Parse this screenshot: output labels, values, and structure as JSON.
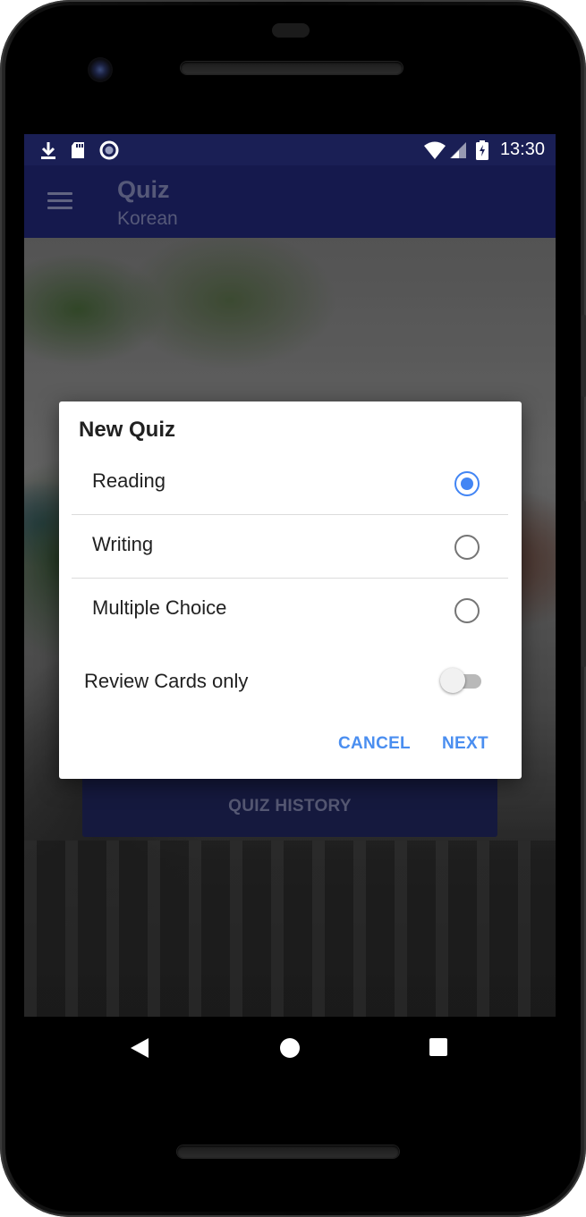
{
  "status_bar": {
    "time": "13:30",
    "left_icons": [
      "download-icon",
      "sd-card-icon",
      "record-icon"
    ],
    "right_icons": [
      "wifi-icon",
      "signal-icon",
      "battery-charging-icon"
    ]
  },
  "app_bar": {
    "title": "Quiz",
    "subtitle": "Korean",
    "menu_icon": "hamburger-menu-icon"
  },
  "background": {
    "quiz_history_label": "QUIZ HISTORY"
  },
  "dialog": {
    "title": "New Quiz",
    "options": [
      {
        "label": "Reading",
        "selected": true
      },
      {
        "label": "Writing",
        "selected": false
      },
      {
        "label": "Multiple Choice",
        "selected": false
      }
    ],
    "review_toggle": {
      "label": "Review Cards only",
      "checked": false
    },
    "cancel_label": "CANCEL",
    "next_label": "NEXT",
    "accent_color": "#4285f4"
  },
  "nav_bar": {
    "icons": [
      "back-icon",
      "home-icon",
      "recents-icon"
    ]
  },
  "colors": {
    "app_bar": "#1b2163",
    "status_bar": "#1a1f55",
    "button_text": "#4a8ef0"
  }
}
